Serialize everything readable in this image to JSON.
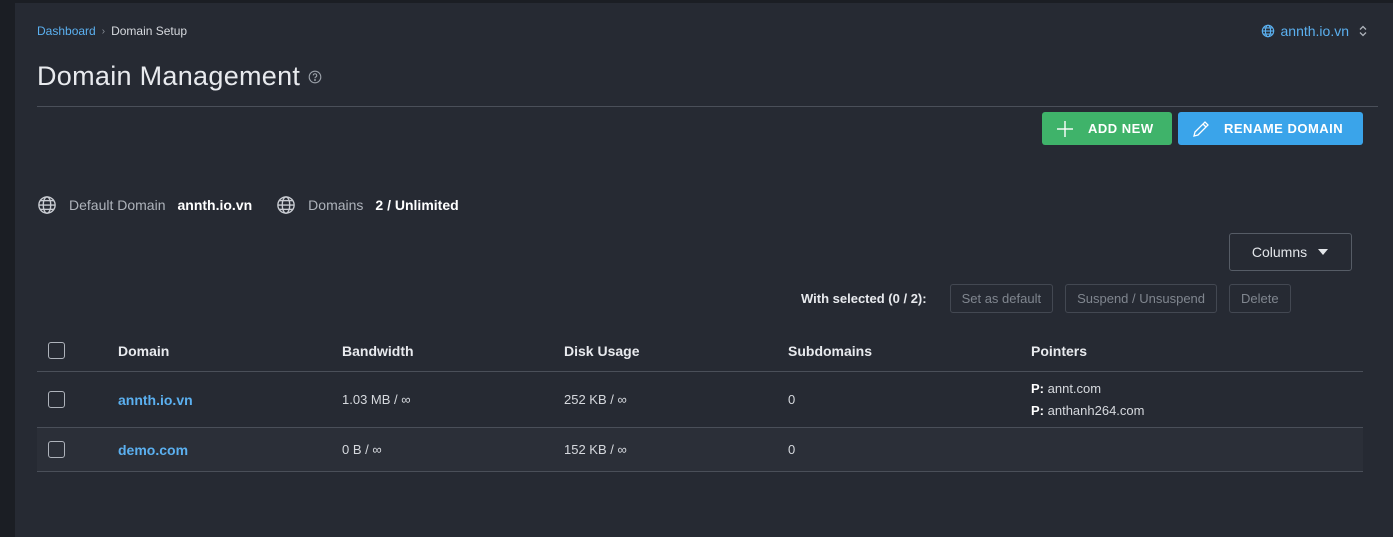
{
  "breadcrumb": {
    "root": "Dashboard",
    "separator": "›",
    "current": "Domain Setup"
  },
  "domain_switcher": {
    "label": "annth.io.vn",
    "icon": "globe-icon",
    "chevron": "up-down-chevron-icon"
  },
  "page": {
    "title": "Domain Management",
    "help_icon": "help-circle-icon"
  },
  "actions": {
    "add_new": "ADD NEW",
    "rename_domain": "RENAME DOMAIN"
  },
  "stats": {
    "default_domain_label": "Default Domain",
    "default_domain_value": "annth.io.vn",
    "domains_label": "Domains",
    "domains_value": "2 / Unlimited"
  },
  "columns_button": "Columns",
  "bulk": {
    "label": "With selected (0 / 2):",
    "set_default": "Set as default",
    "suspend": "Suspend / Unsuspend",
    "delete": "Delete"
  },
  "table": {
    "headers": [
      "Domain",
      "Bandwidth",
      "Disk Usage",
      "Subdomains",
      "Pointers"
    ],
    "rows": [
      {
        "domain": "annth.io.vn",
        "bandwidth": "1.03 MB / ∞",
        "disk": "252 KB / ∞",
        "subdomains": "0",
        "pointers": [
          {
            "prefix": "P:",
            "value": "annt.com"
          },
          {
            "prefix": "P:",
            "value": "anthanh264.com"
          }
        ]
      },
      {
        "domain": "demo.com",
        "bandwidth": "0 B / ∞",
        "disk": "152 KB / ∞",
        "subdomains": "0",
        "pointers": []
      }
    ]
  },
  "colors": {
    "accent": "#3aa4ea",
    "success": "#3fb36a",
    "link": "#5bb0f0",
    "background": "#262a33"
  }
}
